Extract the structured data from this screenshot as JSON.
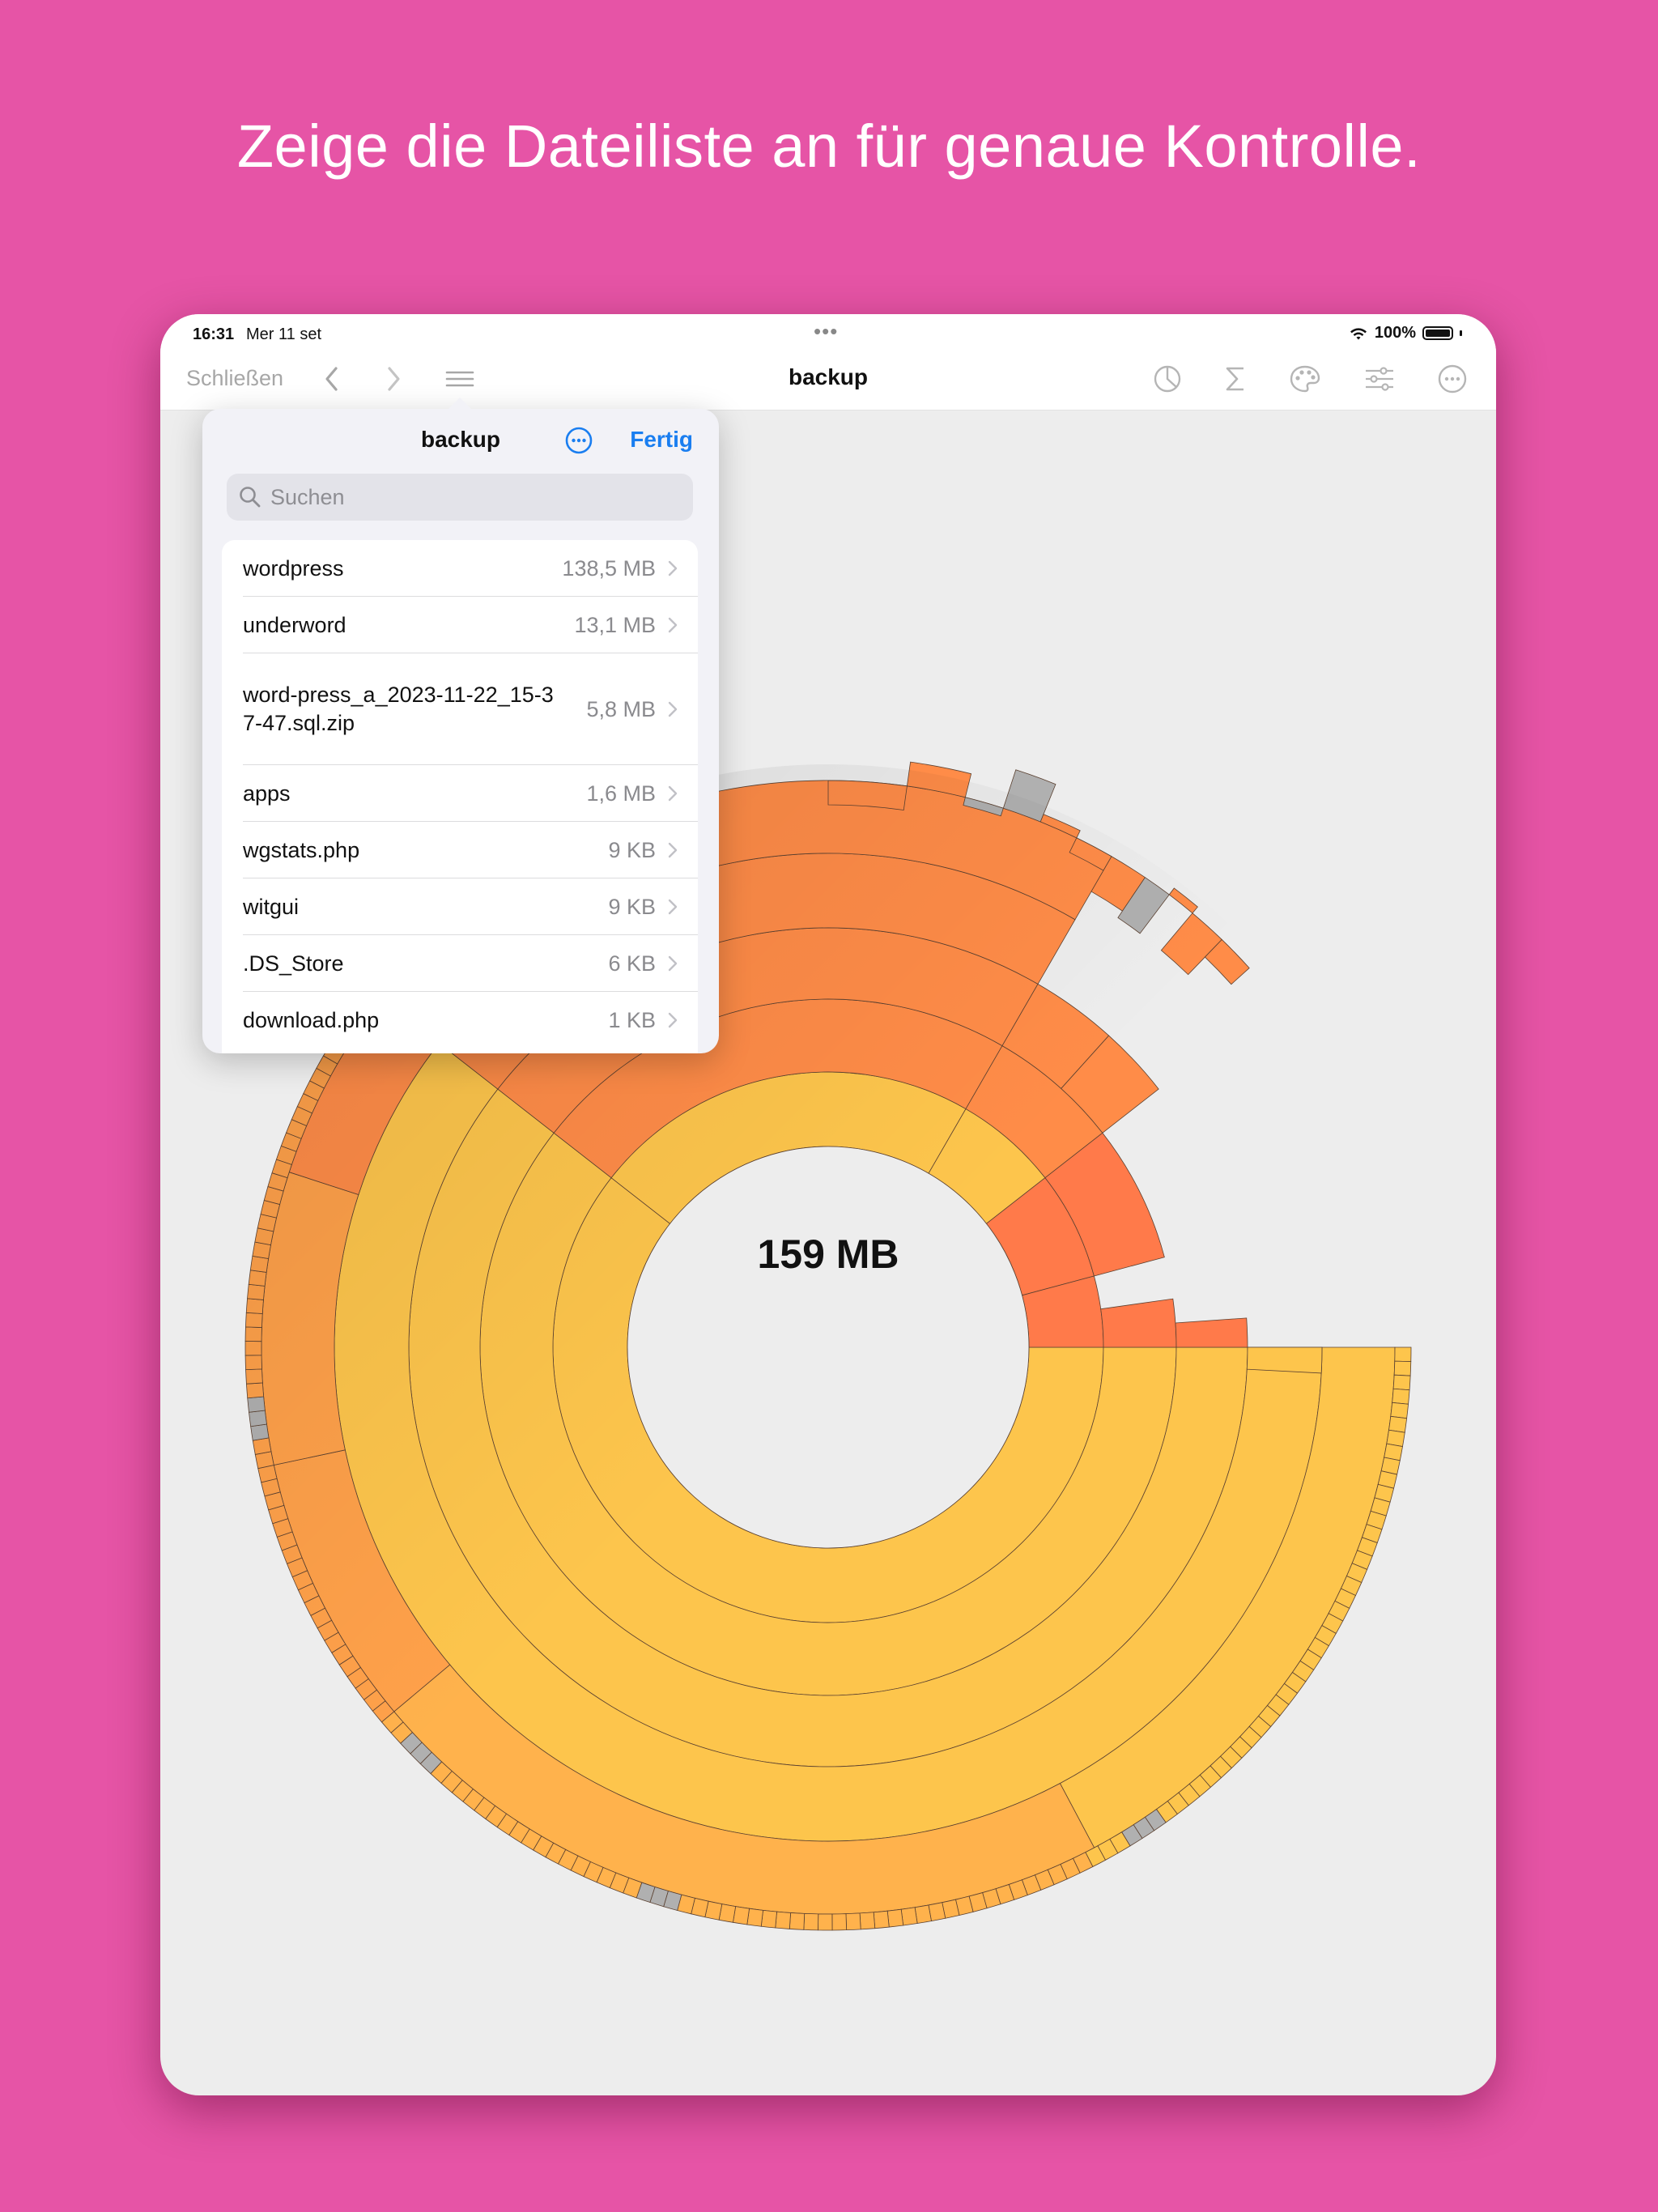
{
  "headline": "Zeige die Dateiliste an für genaue Kontrolle.",
  "status": {
    "time": "16:31",
    "date": "Mer 11 set",
    "battery": "100%"
  },
  "navbar": {
    "close_label": "Schließen",
    "title": "backup",
    "icons": [
      "chevron-left-icon",
      "chevron-right-icon",
      "list-icon",
      "pie-chart-icon",
      "sigma-icon",
      "palette-icon",
      "sliders-icon",
      "ellipsis-circle-icon"
    ]
  },
  "chart": {
    "center_label": "159 MB"
  },
  "popover": {
    "title": "backup",
    "done_label": "Fertig",
    "search_placeholder": "Suchen",
    "items": [
      {
        "name": "wordpress",
        "size": "138,5 MB"
      },
      {
        "name": "underword",
        "size": "13,1 MB"
      },
      {
        "name": "word-press_a_2023-11-22_15-37-47.sql.zip",
        "size": "5,8 MB"
      },
      {
        "name": "apps",
        "size": "1,6 MB"
      },
      {
        "name": "wgstats.php",
        "size": "9 KB"
      },
      {
        "name": "witgui",
        "size": "9 KB"
      },
      {
        "name": ".DS_Store",
        "size": "6 KB"
      },
      {
        "name": "download.php",
        "size": "1 KB"
      }
    ]
  },
  "colors": {
    "background": "#E654A6",
    "accent": "#1A7EF0",
    "ring_yellow": "#FDC54C",
    "ring_orange": "#FF8C48",
    "ring_red_orange": "#FF7A4A",
    "ring_gray": "#B0B0B0"
  }
}
